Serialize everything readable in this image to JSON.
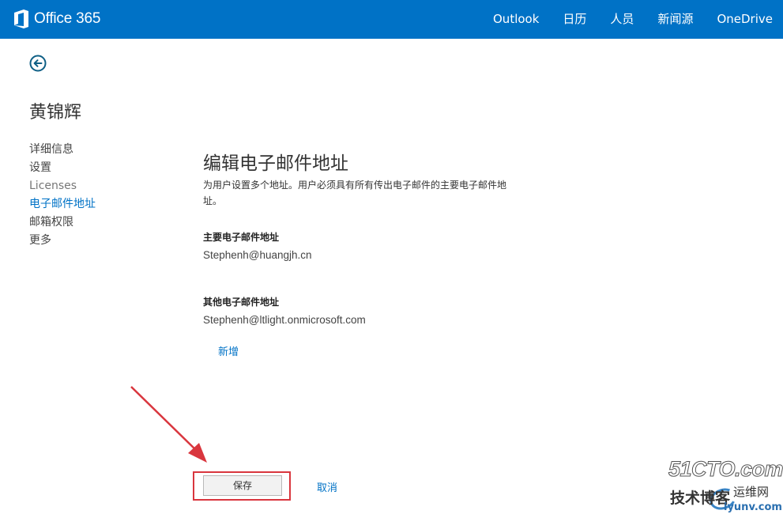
{
  "header": {
    "brand": "Office 365",
    "nav": [
      "Outlook",
      "日历",
      "人员",
      "新闻源",
      "OneDrive"
    ]
  },
  "user": {
    "name": "黄锦辉"
  },
  "sidebar": {
    "items": [
      {
        "label": "详细信息"
      },
      {
        "label": "设置"
      },
      {
        "label": "Licenses"
      },
      {
        "label": "电子邮件地址"
      },
      {
        "label": "邮箱权限"
      },
      {
        "label": "更多"
      }
    ],
    "active_index": 3
  },
  "main": {
    "title": "编辑电子邮件地址",
    "description": "为用户设置多个地址。用户必须具有所有传出电子邮件的主要电子邮件地址。",
    "primary_label": "主要电子邮件地址",
    "primary_value": "Stephenh@huangjh.cn",
    "other_label": "其他电子邮件地址",
    "other_value": "Stephenh@ltlight.onmicrosoft.com",
    "add_label": "新增"
  },
  "actions": {
    "save_label": "保存",
    "cancel_label": "取消"
  },
  "watermark": {
    "main": "51CTO.com",
    "left": "技术博客",
    "right": "运维网",
    "url": "iyunv.com"
  },
  "colors": {
    "brand": "#0072c6",
    "annotation": "#d9363e"
  }
}
